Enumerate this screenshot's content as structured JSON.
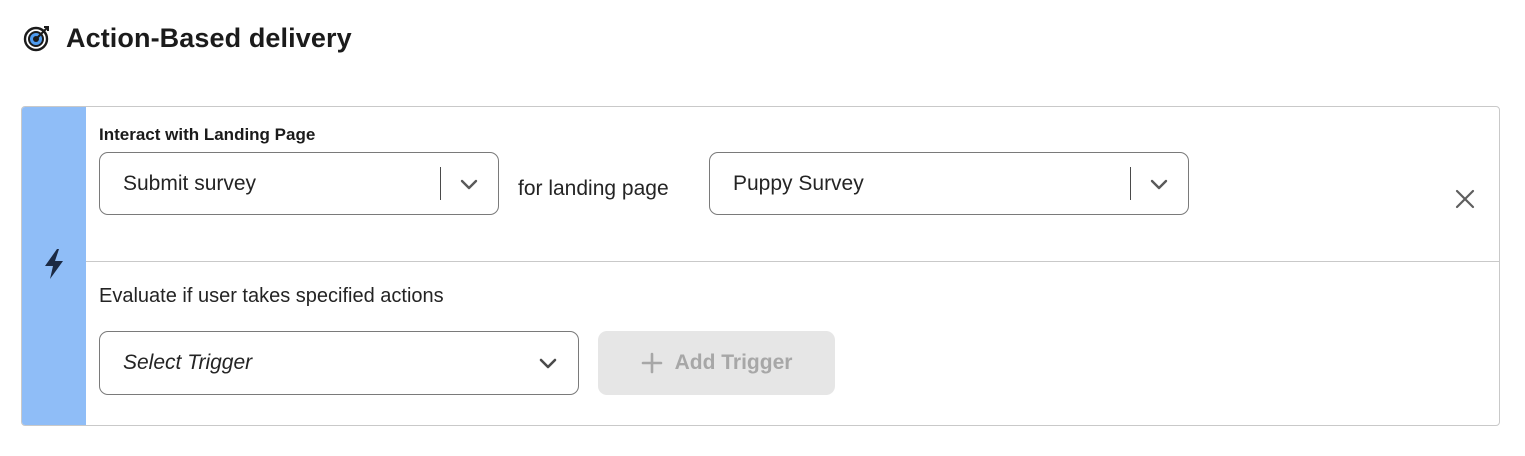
{
  "header": {
    "title": "Action-Based delivery",
    "icon": "target-icon"
  },
  "rule": {
    "rail_icon": "lightning-bolt-icon",
    "rail_color": "#8fbdf7",
    "section_label": "Interact with Landing Page",
    "action_select": {
      "value": "Submit survey"
    },
    "connector_text": "for landing page",
    "landing_page_select": {
      "value": "Puppy Survey"
    },
    "remove_icon": "close-icon",
    "evaluate_label": "Evaluate if user takes specified actions",
    "trigger_select": {
      "placeholder": "Select Trigger"
    },
    "add_trigger_label": "Add Trigger",
    "add_trigger_disabled": true
  }
}
